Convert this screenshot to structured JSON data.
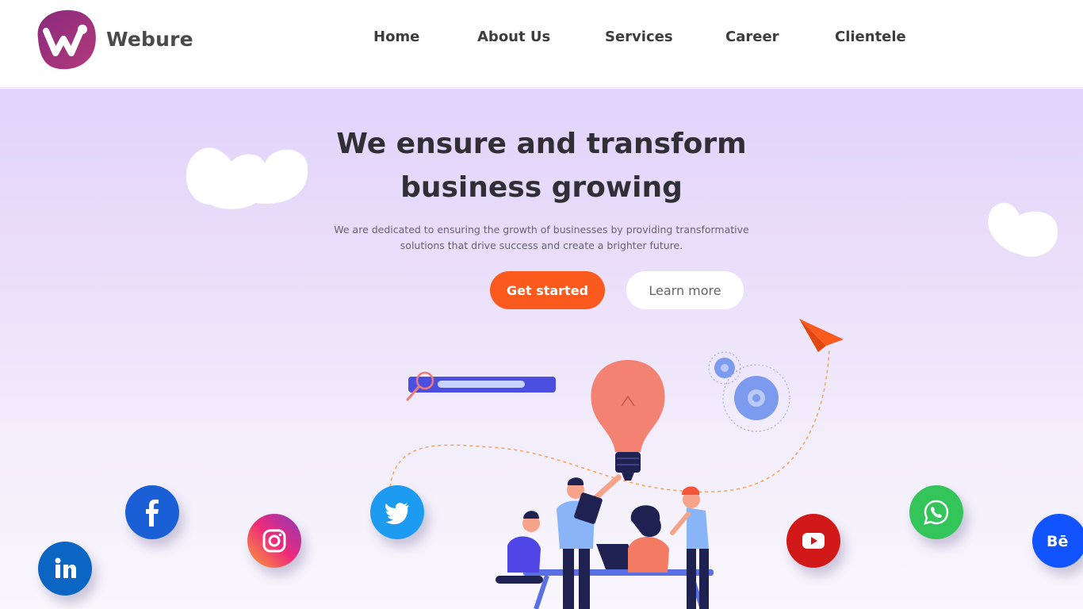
{
  "header": {
    "brand": "Webure",
    "nav": [
      {
        "label": "Home"
      },
      {
        "label": "About Us"
      },
      {
        "label": "Services"
      },
      {
        "label": "Career"
      },
      {
        "label": "Clientele"
      }
    ]
  },
  "hero": {
    "headline_line1": "We ensure and transform",
    "headline_line2": "business growing",
    "subtext_line1": "We are dedicated to ensuring the growth of businesses by providing transformative",
    "subtext_line2": "solutions that drive success and create a brighter future.",
    "primary_button": "Get started",
    "secondary_button": "Learn more"
  },
  "social_icons": [
    "linkedin-icon",
    "facebook-icon",
    "instagram-icon",
    "twitter-icon",
    "youtube-icon",
    "whatsapp-icon",
    "behance-icon"
  ],
  "colors": {
    "accent": "#fa5a1e",
    "brand_purple": "#7b2d8e",
    "hero_top": "#e1d3fb",
    "hero_bottom": "#f9f7fc"
  }
}
